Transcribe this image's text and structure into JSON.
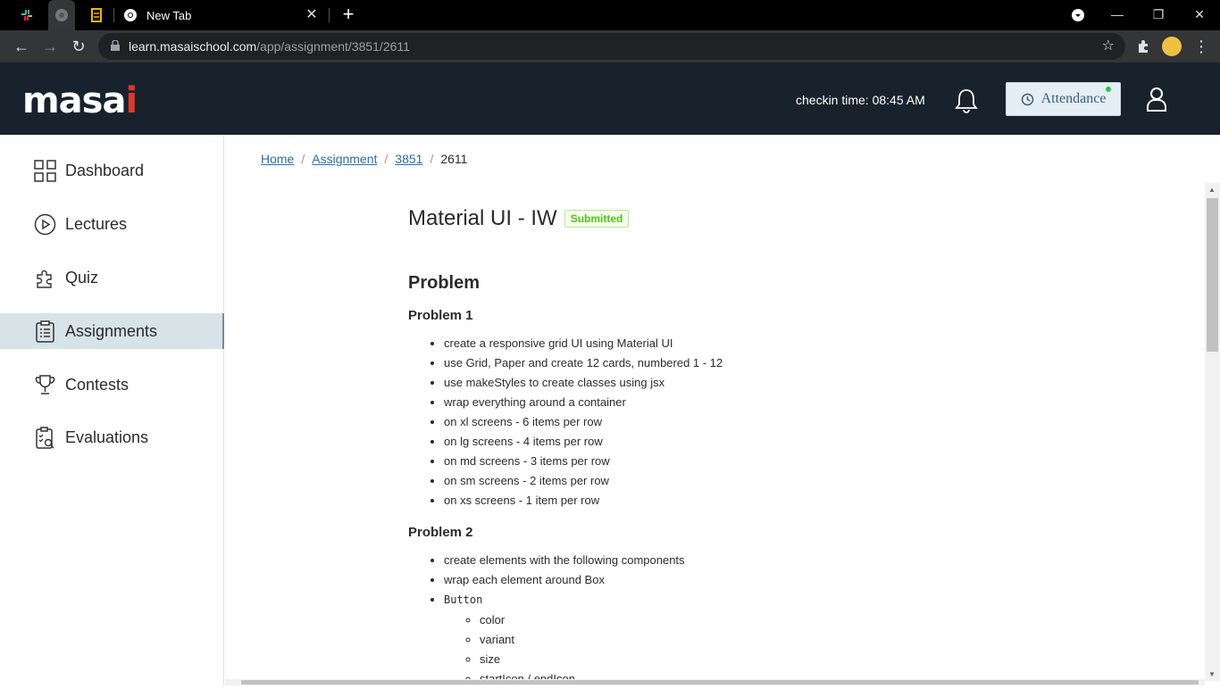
{
  "browser": {
    "tab_title": "New Tab",
    "url_host": "learn.masaischool.com",
    "url_path": "/app/assignment/3851/2611"
  },
  "header": {
    "logo_main": "masa",
    "logo_end": "i",
    "checkin": "checkin time: 08:45 AM",
    "attendance_label": "Attendance",
    "colors": {
      "bg": "#18222c",
      "accent": "#e2352b"
    }
  },
  "sidebar": {
    "items": [
      {
        "label": "Dashboard",
        "icon": "grid-icon"
      },
      {
        "label": "Lectures",
        "icon": "play-circle-icon"
      },
      {
        "label": "Quiz",
        "icon": "puzzle-icon"
      },
      {
        "label": "Assignments",
        "icon": "clipboard-icon",
        "active": true
      },
      {
        "label": "Contests",
        "icon": "trophy-icon"
      },
      {
        "label": "Evaluations",
        "icon": "checklist-icon"
      }
    ]
  },
  "breadcrumb": [
    "Home",
    "Assignment",
    "3851",
    "2611"
  ],
  "assignment": {
    "title": "Material UI - IW",
    "status": "Submitted",
    "section": "Problem",
    "problem1": {
      "heading": "Problem 1",
      "items": [
        "create a responsive grid UI using Material UI",
        "use Grid, Paper and create 12 cards, numbered 1 - 12",
        "use makeStyles to create classes using jsx",
        "wrap everything around a container",
        "on xl screens - 6 items per row",
        "on lg screens - 4 items per row",
        "on md screens - 3 items per row",
        "on sm screens - 2 items per row",
        "on xs screens - 1 item per row"
      ]
    },
    "problem2": {
      "heading": "Problem 2",
      "items": [
        "create elements with the following components",
        "wrap each element around Box"
      ],
      "button_label": "Button",
      "button_props": [
        "color",
        "variant",
        "size",
        "startIcon / endIcon"
      ]
    }
  }
}
